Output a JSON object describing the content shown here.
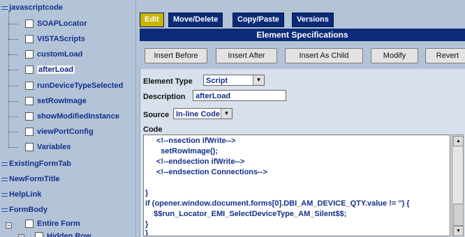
{
  "tree": {
    "root_label": "javascriptcode",
    "children": [
      "SOAPLocator",
      "VISTAScripts",
      "customLoad",
      "afterLoad",
      "runDeviceTypeSelected",
      "setRowImage",
      "showModifiedInstance",
      "viewPortConfig",
      "Variables"
    ],
    "siblings": [
      "ExistingFormTab",
      "NewFormTitle",
      "HelpLink",
      "FormBody"
    ],
    "entire_form": "Entire Form",
    "cut_off_item": "Hidden Row"
  },
  "tabs": [
    "Edit",
    "Move/Delete",
    "Copy/Paste",
    "Versions"
  ],
  "spec_title": "Element Specifications",
  "actions": [
    "Insert Before",
    "Insert After",
    "Insert As Child",
    "Modify",
    "Revert"
  ],
  "form": {
    "element_type_label": "Element Type",
    "element_type_value": "Script",
    "description_label": "Description",
    "description_value": "afterLoad",
    "source_label": "Source",
    "source_value": "In-line Code",
    "code_label": "Code"
  },
  "code_lines": [
    "<!--nsection ifWrite-->",
    "  setRowImage();",
    "<!--endsection ifWrite-->",
    "<!--endsection Connections-->",
    "",
    "}",
    "if (opener.window.document.forms[0].DBI_AM_DEVICE_QTY.value != '') {",
    "  $$run_Locator_EMI_SelectDeviceType_AM_Silent$$;",
    "}",
    "}"
  ]
}
